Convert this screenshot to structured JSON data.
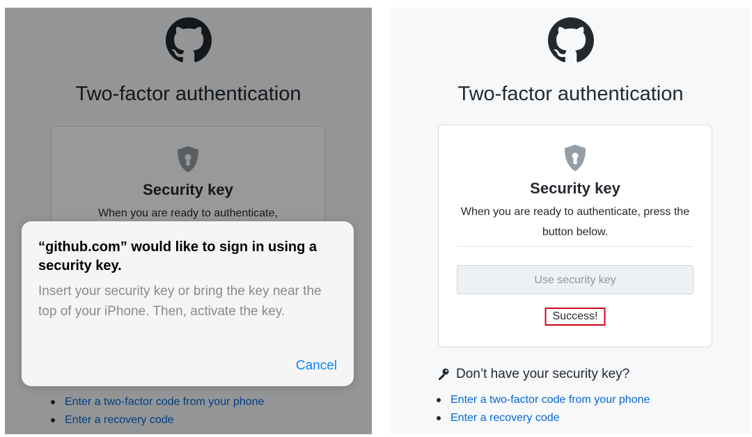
{
  "left": {
    "title": "Two-factor authentication",
    "card": {
      "title": "Security key",
      "desc": "When you are ready to authenticate,"
    },
    "alert": {
      "title": "“github.com” would like to sign in using a security key.",
      "message": "Insert your security key or bring the key near the top of your iPhone. Then, activate the key.",
      "cancel": "Cancel"
    },
    "links": [
      "Enter a two-factor code from your phone",
      "Enter a recovery code"
    ]
  },
  "right": {
    "title": "Two-factor authentication",
    "card": {
      "title": "Security key",
      "desc": "When you are ready to authenticate, press the button below.",
      "button": "Use security key",
      "success": "Success!"
    },
    "no_key_heading": "Don’t have your security key?",
    "links": [
      "Enter a two-factor code from your phone",
      "Enter a recovery code"
    ]
  },
  "colors": {
    "link": "#0366d6",
    "success_border": "#d0021b",
    "ios_blue": "#0a84ff"
  },
  "icons": {
    "logo": "github-logo",
    "shield": "shield-icon",
    "key": "key-icon"
  }
}
